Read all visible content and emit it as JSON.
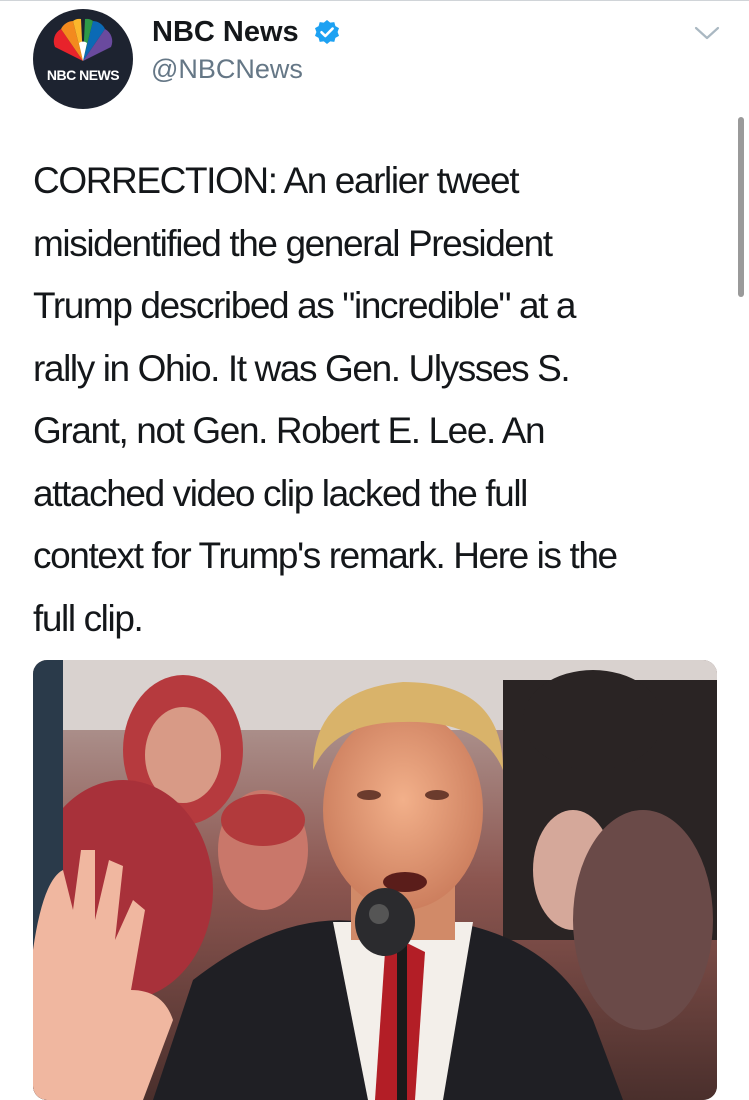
{
  "tweet": {
    "author": {
      "name": "NBC News",
      "handle": "@NBCNews",
      "verified": true,
      "avatar_label": "NBC NEWS"
    },
    "text": "CORRECTION: An earlier tweet\nmisidentified the general President\nTrump described as \"incredible\" at a\nrally in Ohio. It was Gen. Ulysses S.\nGrant, not Gen. Robert E. Lee. An\nattached video clip lacked the full\ncontext for Trump's remark. Here is the\nfull clip.",
    "media": {
      "type": "video"
    }
  },
  "icons": {
    "verified": "verified-badge-icon",
    "caret": "chevron-down-icon"
  },
  "colors": {
    "verified_blue": "#1da1f2",
    "handle_gray": "#657786",
    "text": "#14171a"
  }
}
